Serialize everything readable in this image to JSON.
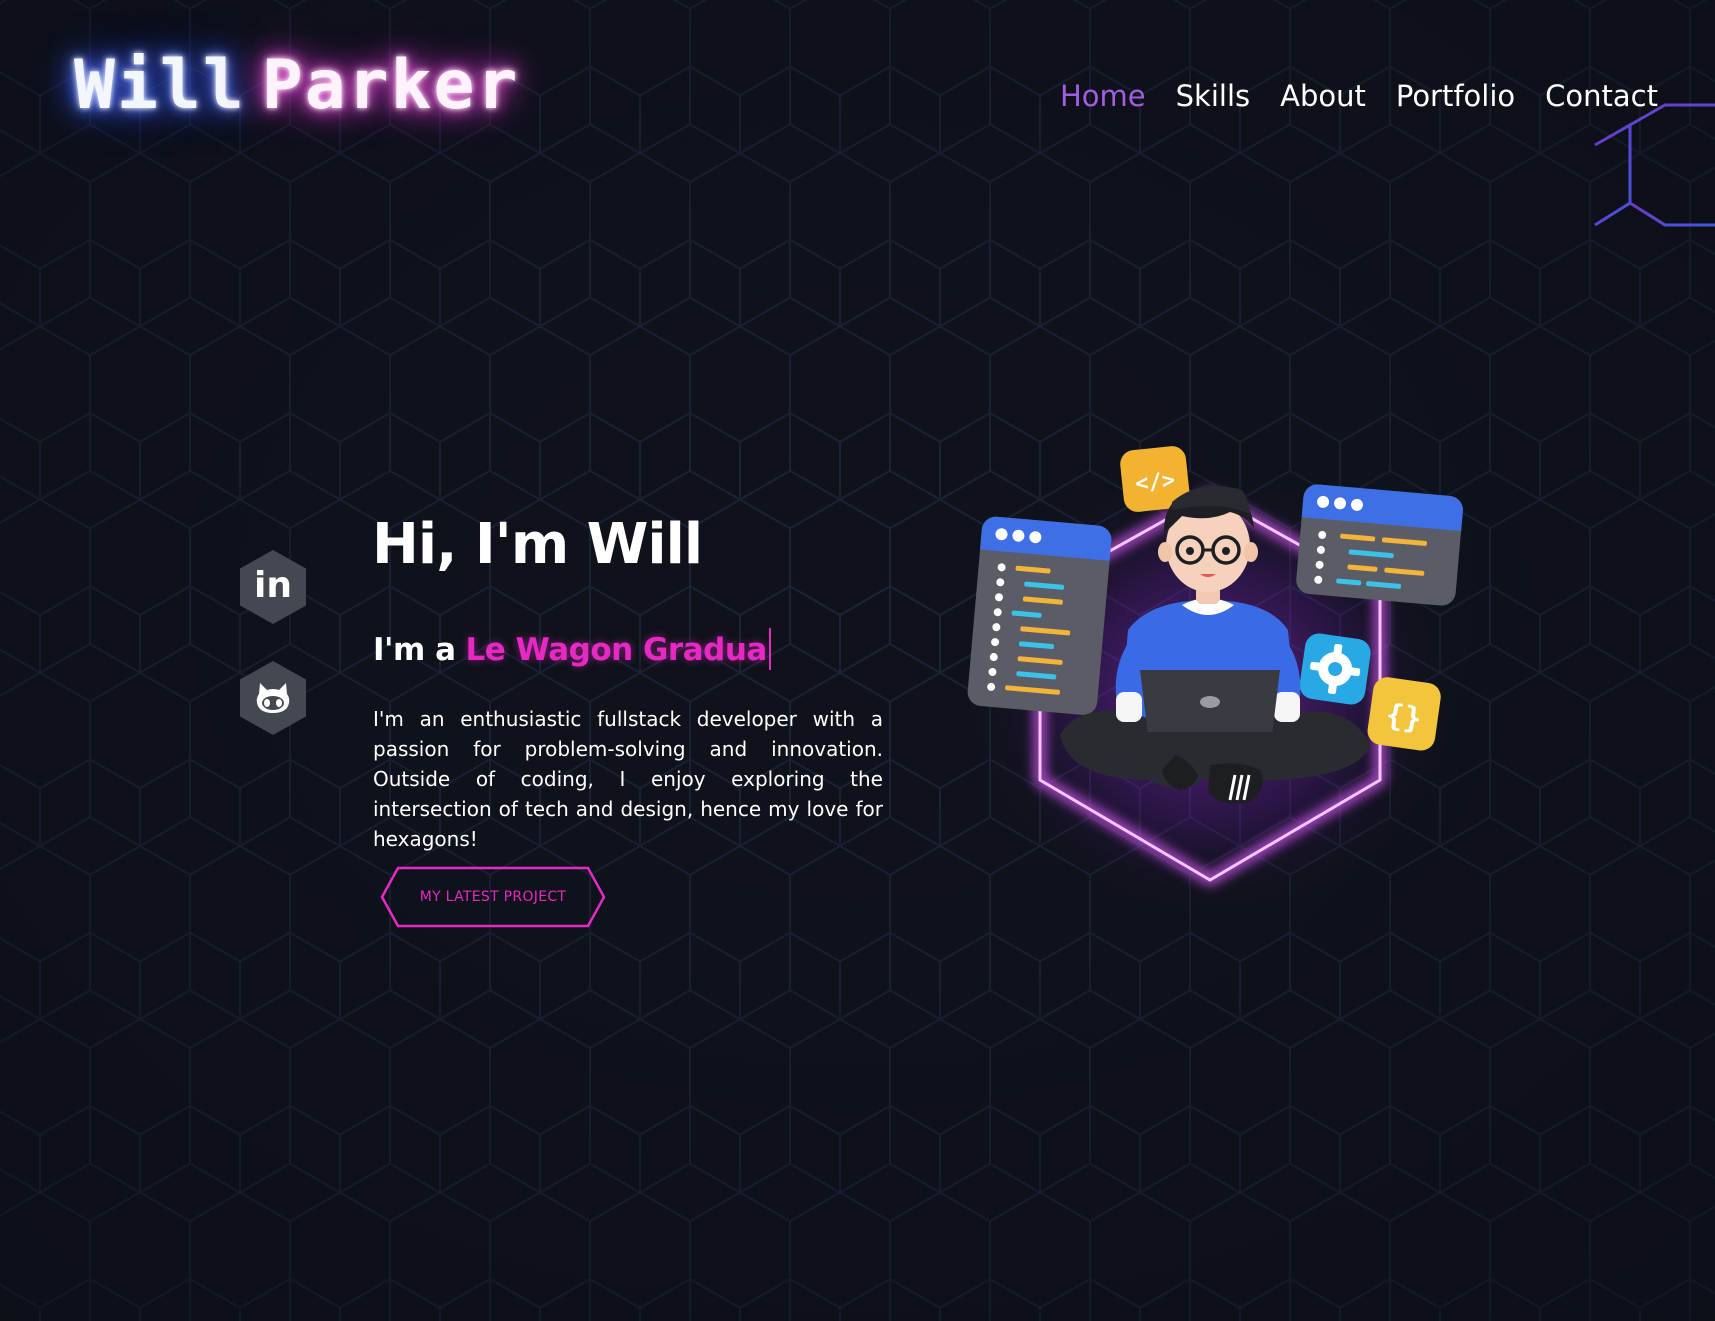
{
  "header": {
    "logo_first": "Will",
    "logo_last": "Parker",
    "nav": [
      {
        "label": "Home",
        "active": true
      },
      {
        "label": "Skills",
        "active": false
      },
      {
        "label": "About",
        "active": false
      },
      {
        "label": "Portfolio",
        "active": false
      },
      {
        "label": "Contact",
        "active": false
      }
    ]
  },
  "social": {
    "linkedin": {
      "icon": "linkedin-icon",
      "glyph": "in"
    },
    "github": {
      "icon": "github-icon"
    }
  },
  "hero": {
    "title": "Hi, I'm Will",
    "subtitle_prefix": "I'm a",
    "typed_text": "Le Wagon Gradua",
    "description": "I'm an enthusiastic fullstack developer with a passion for problem-solving and innovation. Outside of coding, I enjoy exploring the intersection of tech and design, hence my love for hexagons!",
    "cta_label": "MY LATEST PROJECT"
  },
  "illustration": {
    "badges": {
      "code": "</>",
      "braces": "{}"
    }
  },
  "colors": {
    "background": "#0f121b",
    "accent_pink": "#e629c3",
    "nav_active": "#a25de0",
    "hex_line": "#1b2540"
  }
}
